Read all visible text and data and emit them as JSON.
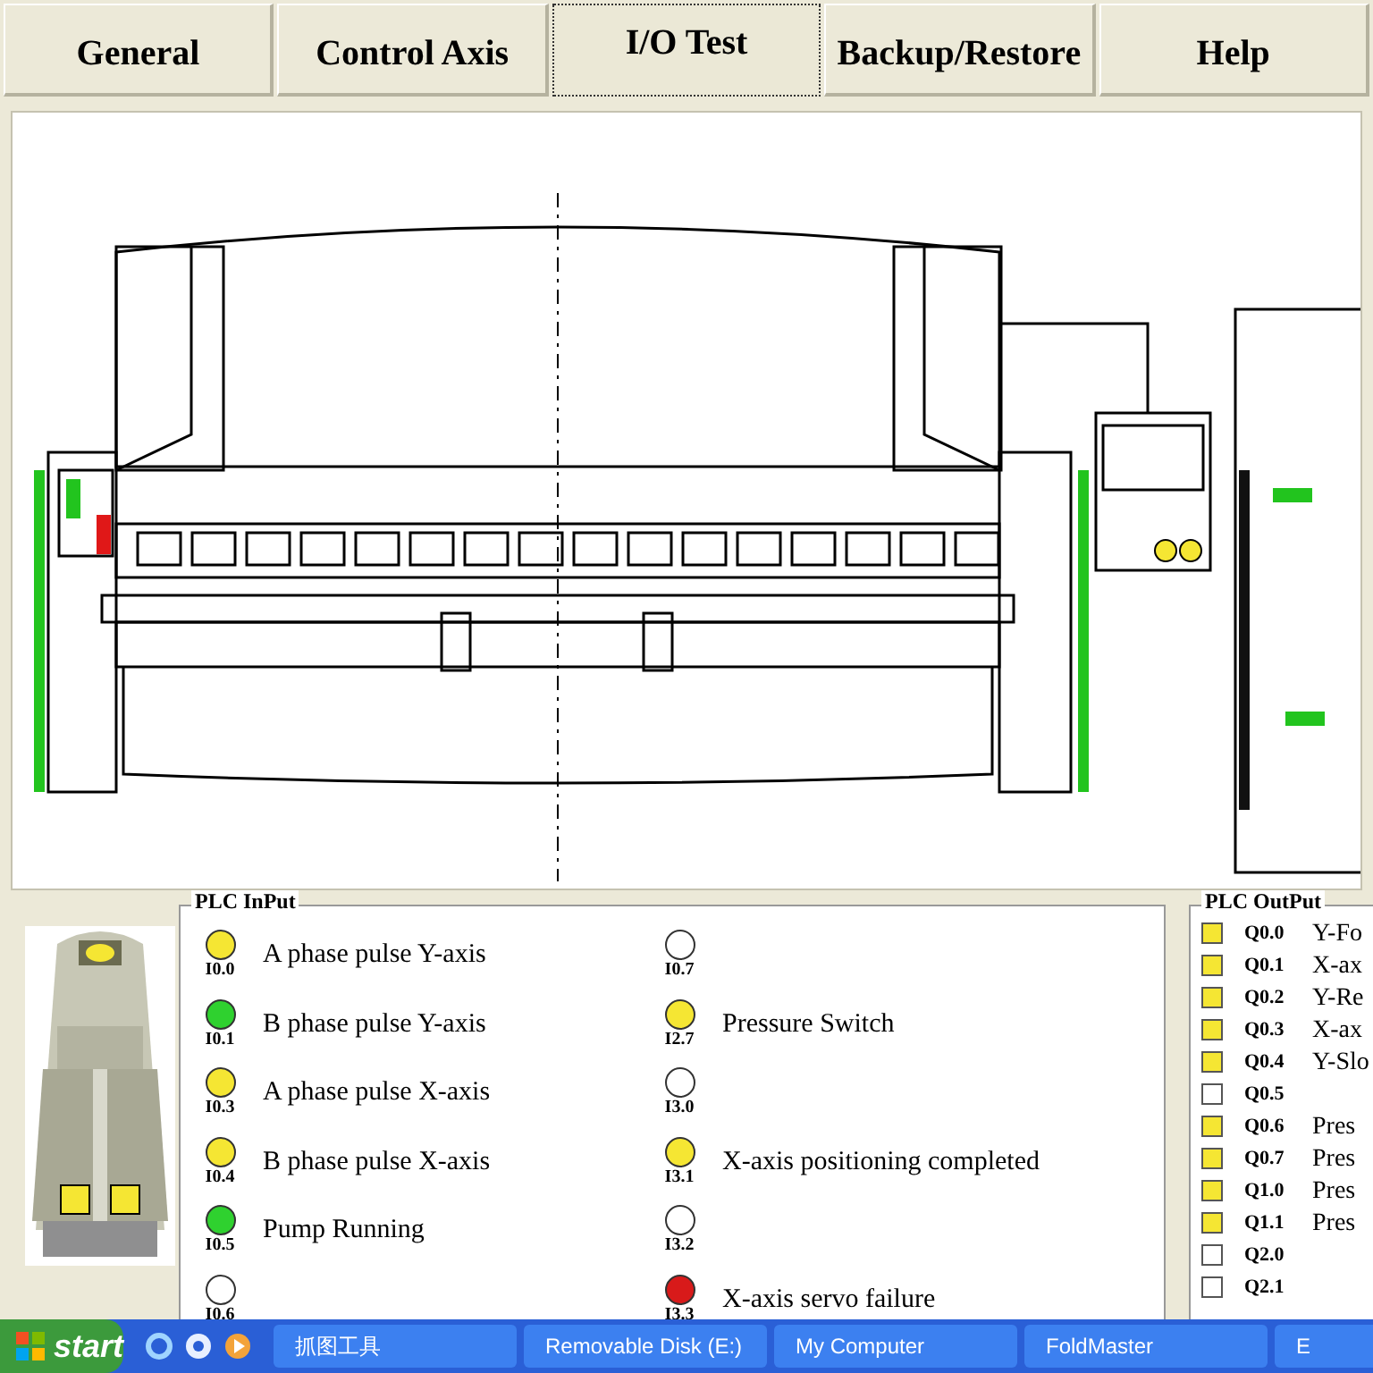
{
  "tabs": [
    {
      "label": "General",
      "selected": false
    },
    {
      "label": "Control Axis",
      "selected": false
    },
    {
      "label": "I/O Test",
      "selected": true
    },
    {
      "label": "Backup/Restore",
      "selected": false
    },
    {
      "label": "Help",
      "selected": false
    }
  ],
  "plc_input": {
    "title": "PLC InPut",
    "columns": [
      [
        {
          "label": "I0.0",
          "text": "A phase pulse Y-axis",
          "color": "#f5e633"
        },
        {
          "label": "I0.1",
          "text": "B phase pulse Y-axis",
          "color": "#2fd12f"
        },
        {
          "label": "I0.3",
          "text": "A phase pulse X-axis",
          "color": "#f5e633"
        },
        {
          "label": "I0.4",
          "text": "B phase pulse X-axis",
          "color": "#f5e633"
        },
        {
          "label": "I0.5",
          "text": "Pump Running",
          "color": "#2fd12f"
        },
        {
          "label": "I0.6",
          "color": "#ffffff"
        }
      ],
      [
        {
          "label": "I0.7",
          "color": "#ffffff"
        },
        {
          "label": "I2.7",
          "text": "Pressure Switch",
          "color": "#f5e633"
        },
        {
          "label": "I3.0",
          "color": "#ffffff"
        },
        {
          "label": "I3.1",
          "text": "X-axis positioning completed",
          "color": "#f5e633"
        },
        {
          "label": "I3.2",
          "color": "#ffffff"
        },
        {
          "label": "I3.3",
          "text": "X-axis servo failure",
          "color": "#d81a1a"
        }
      ]
    ]
  },
  "plc_output": {
    "title": "PLC OutPut",
    "items": [
      {
        "label": "Q0.0",
        "text": "Y-Fo",
        "on": true
      },
      {
        "label": "Q0.1",
        "text": "X-ax",
        "on": true
      },
      {
        "label": "Q0.2",
        "text": "Y-Re",
        "on": true
      },
      {
        "label": "Q0.3",
        "text": "X-ax",
        "on": true
      },
      {
        "label": "Q0.4",
        "text": "Y-Slo",
        "on": true
      },
      {
        "label": "Q0.5",
        "on": false
      },
      {
        "label": "Q0.6",
        "text": "Pres",
        "on": true
      },
      {
        "label": "Q0.7",
        "text": "Pres",
        "on": true
      },
      {
        "label": "Q1.0",
        "text": "Pres",
        "on": true
      },
      {
        "label": "Q1.1",
        "text": "Pres",
        "on": true
      },
      {
        "label": "Q2.0",
        "on": false
      },
      {
        "label": "Q2.1",
        "on": false
      }
    ]
  },
  "taskbar": {
    "start": "start",
    "tasks": [
      "抓图工具",
      "Removable Disk (E:)",
      "My Computer",
      "FoldMaster",
      "E"
    ]
  }
}
